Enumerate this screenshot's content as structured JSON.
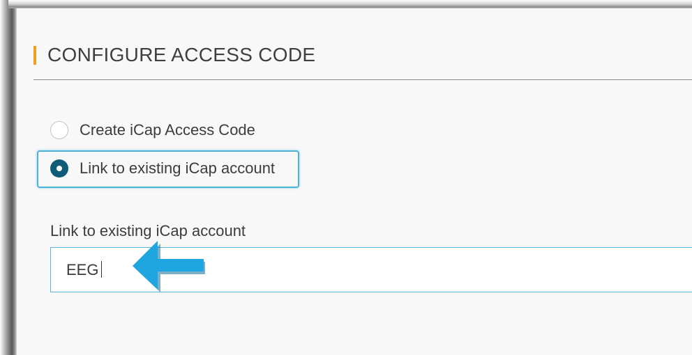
{
  "section": {
    "title": "CONFIGURE ACCESS CODE",
    "accent_color": "#f0a020"
  },
  "options": [
    {
      "label": "Create iCap Access Code",
      "selected": false
    },
    {
      "label": "Link to existing iCap account",
      "selected": true
    }
  ],
  "field": {
    "label": "Link to existing iCap account",
    "required_marker": "*",
    "value": "EEG",
    "focus_color": "#58b4dc"
  },
  "annotation": {
    "icon": "arrow-left-icon",
    "color": "#1fa6e0"
  },
  "colors": {
    "radio_selected": "#0e5c78",
    "highlight_border": "#4bb3d8"
  }
}
